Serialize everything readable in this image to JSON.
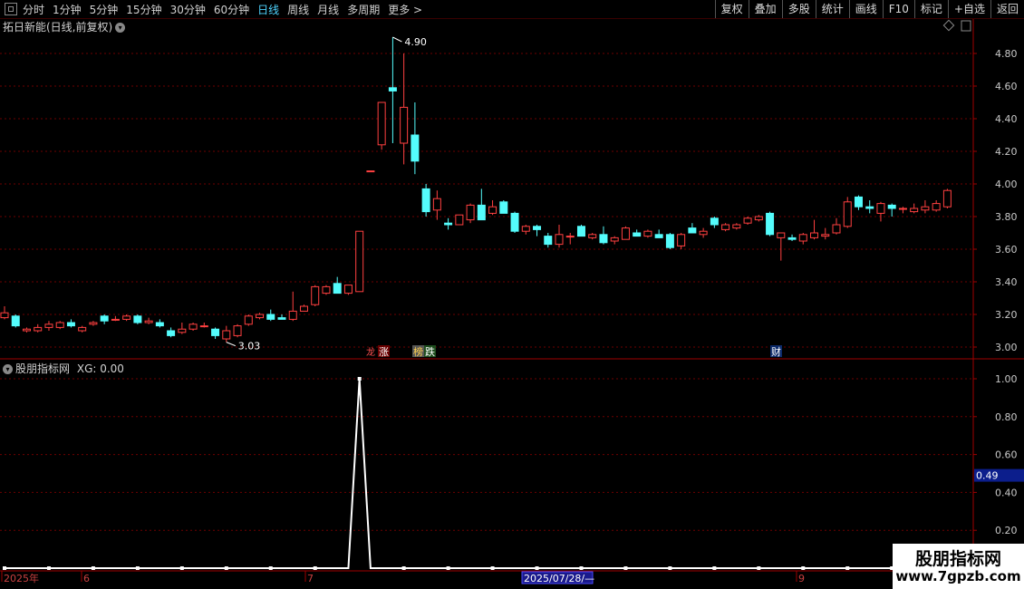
{
  "toolbar": {
    "periods": [
      "分时",
      "1分钟",
      "5分钟",
      "15分钟",
      "30分钟",
      "60分钟",
      "日线",
      "周线",
      "月线",
      "多周期",
      "更多 >"
    ],
    "active_period": "日线",
    "buttons": [
      "复权",
      "叠加",
      "多股",
      "统计",
      "画线",
      "F10",
      "标记",
      "+自选",
      "返回"
    ]
  },
  "main_panel": {
    "title": "拓日新能(日线,前复权)",
    "high_label": "4.90",
    "low_label": "3.03",
    "events": [
      "涨",
      "跌",
      "财"
    ],
    "event_prefix": [
      "龙",
      "榜"
    ]
  },
  "indicator_panel": {
    "title": "股朋指标网",
    "value_text": "XG: 0.00",
    "current_value": "0.49"
  },
  "colors": {
    "up": "#ff4040",
    "down": "#54fcfc",
    "grid": "#6e0000",
    "border": "#a00000",
    "axis_text": "#c8c8c8",
    "line": "#ffffff"
  },
  "chart_data": {
    "type": "candlestick",
    "ylim": [
      2.95,
      5.0
    ],
    "y_ticks": [
      "4.80",
      "4.60",
      "4.40",
      "4.20",
      "4.00",
      "3.80",
      "3.60",
      "3.40",
      "3.20",
      "3.00"
    ],
    "ind_ylim": [
      0,
      1.1
    ],
    "ind_ticks": [
      "1.00",
      "0.80",
      "0.60",
      "0.40",
      "0.20"
    ],
    "x_labels": [
      "2025年",
      "6",
      "7",
      "2025/07/28/—",
      "9"
    ],
    "ohlc": [
      [
        3.18,
        3.25,
        3.17,
        3.21
      ],
      [
        3.19,
        3.2,
        3.12,
        3.13
      ],
      [
        3.1,
        3.12,
        3.09,
        3.11
      ],
      [
        3.1,
        3.14,
        3.09,
        3.12
      ],
      [
        3.12,
        3.16,
        3.1,
        3.14
      ],
      [
        3.12,
        3.16,
        3.11,
        3.15
      ],
      [
        3.15,
        3.17,
        3.12,
        3.13
      ],
      [
        3.1,
        3.13,
        3.09,
        3.12
      ],
      [
        3.14,
        3.16,
        3.13,
        3.15
      ],
      [
        3.19,
        3.2,
        3.14,
        3.16
      ],
      [
        3.17,
        3.19,
        3.16,
        3.17
      ],
      [
        3.17,
        3.2,
        3.16,
        3.19
      ],
      [
        3.19,
        3.2,
        3.14,
        3.15
      ],
      [
        3.15,
        3.18,
        3.14,
        3.16
      ],
      [
        3.15,
        3.17,
        3.12,
        3.13
      ],
      [
        3.1,
        3.12,
        3.06,
        3.07
      ],
      [
        3.09,
        3.15,
        3.08,
        3.11
      ],
      [
        3.11,
        3.15,
        3.1,
        3.14
      ],
      [
        3.13,
        3.15,
        3.12,
        3.13
      ],
      [
        3.11,
        3.12,
        3.05,
        3.07
      ],
      [
        3.05,
        3.13,
        3.03,
        3.1
      ],
      [
        3.07,
        3.14,
        3.06,
        3.13
      ],
      [
        3.14,
        3.2,
        3.13,
        3.19
      ],
      [
        3.18,
        3.21,
        3.17,
        3.2
      ],
      [
        3.2,
        3.23,
        3.16,
        3.17
      ],
      [
        3.18,
        3.2,
        3.17,
        3.17
      ],
      [
        3.17,
        3.34,
        3.16,
        3.22
      ],
      [
        3.22,
        3.26,
        3.22,
        3.25
      ],
      [
        3.26,
        3.38,
        3.25,
        3.37
      ],
      [
        3.33,
        3.38,
        3.32,
        3.37
      ],
      [
        3.39,
        3.43,
        3.33,
        3.33
      ],
      [
        3.33,
        3.38,
        3.32,
        3.38
      ],
      [
        3.34,
        3.71,
        3.34,
        3.71
      ],
      [
        4.08,
        4.08,
        4.08,
        4.08
      ],
      [
        4.24,
        4.5,
        4.21,
        4.5
      ],
      [
        4.59,
        4.9,
        4.25,
        4.57
      ],
      [
        4.25,
        4.8,
        4.12,
        4.47
      ],
      [
        4.3,
        4.5,
        4.06,
        4.14
      ],
      [
        3.97,
        4.0,
        3.8,
        3.83
      ],
      [
        3.84,
        3.96,
        3.78,
        3.91
      ],
      [
        3.76,
        3.79,
        3.72,
        3.75
      ],
      [
        3.75,
        3.81,
        3.75,
        3.81
      ],
      [
        3.78,
        3.88,
        3.76,
        3.87
      ],
      [
        3.87,
        3.97,
        3.78,
        3.78
      ],
      [
        3.82,
        3.9,
        3.81,
        3.86
      ],
      [
        3.89,
        3.9,
        3.82,
        3.82
      ],
      [
        3.82,
        3.83,
        3.7,
        3.71
      ],
      [
        3.71,
        3.75,
        3.69,
        3.74
      ],
      [
        3.74,
        3.75,
        3.68,
        3.72
      ],
      [
        3.68,
        3.7,
        3.61,
        3.63
      ],
      [
        3.63,
        3.75,
        3.61,
        3.69
      ],
      [
        3.68,
        3.7,
        3.63,
        3.68
      ],
      [
        3.74,
        3.75,
        3.68,
        3.68
      ],
      [
        3.67,
        3.7,
        3.66,
        3.69
      ],
      [
        3.69,
        3.74,
        3.63,
        3.64
      ],
      [
        3.65,
        3.68,
        3.63,
        3.67
      ],
      [
        3.66,
        3.74,
        3.66,
        3.73
      ],
      [
        3.7,
        3.72,
        3.68,
        3.68
      ],
      [
        3.68,
        3.72,
        3.67,
        3.71
      ],
      [
        3.69,
        3.72,
        3.67,
        3.67
      ],
      [
        3.69,
        3.7,
        3.6,
        3.61
      ],
      [
        3.62,
        3.7,
        3.6,
        3.69
      ],
      [
        3.73,
        3.76,
        3.7,
        3.7
      ],
      [
        3.69,
        3.73,
        3.67,
        3.71
      ],
      [
        3.79,
        3.8,
        3.73,
        3.75
      ],
      [
        3.72,
        3.76,
        3.71,
        3.75
      ],
      [
        3.73,
        3.76,
        3.72,
        3.75
      ],
      [
        3.76,
        3.8,
        3.75,
        3.79
      ],
      [
        3.78,
        3.81,
        3.77,
        3.8
      ],
      [
        3.82,
        3.83,
        3.68,
        3.69
      ],
      [
        3.67,
        3.7,
        3.53,
        3.7
      ],
      [
        3.67,
        3.69,
        3.65,
        3.66
      ],
      [
        3.65,
        3.7,
        3.63,
        3.69
      ],
      [
        3.67,
        3.78,
        3.66,
        3.7
      ],
      [
        3.68,
        3.73,
        3.66,
        3.69
      ],
      [
        3.7,
        3.79,
        3.69,
        3.75
      ],
      [
        3.74,
        3.92,
        3.73,
        3.89
      ],
      [
        3.92,
        3.93,
        3.84,
        3.86
      ],
      [
        3.86,
        3.9,
        3.82,
        3.85
      ],
      [
        3.82,
        3.89,
        3.77,
        3.88
      ],
      [
        3.87,
        3.88,
        3.8,
        3.85
      ],
      [
        3.85,
        3.86,
        3.82,
        3.85
      ],
      [
        3.83,
        3.88,
        3.82,
        3.85
      ],
      [
        3.84,
        3.9,
        3.82,
        3.86
      ],
      [
        3.84,
        3.9,
        3.83,
        3.88
      ],
      [
        3.86,
        3.97,
        3.85,
        3.96
      ]
    ],
    "xg_values": [
      0,
      0,
      0,
      0,
      0,
      0,
      0,
      0,
      0,
      0,
      0,
      0,
      0,
      0,
      0,
      0,
      0,
      0,
      0,
      0,
      0,
      0,
      0,
      0,
      0,
      0,
      0,
      0,
      0,
      0,
      0,
      0,
      1,
      0,
      0,
      0,
      0,
      0,
      0,
      0,
      0,
      0,
      0,
      0,
      0,
      0,
      0,
      0,
      0,
      0,
      0,
      0,
      0,
      0,
      0,
      0,
      0,
      0,
      0,
      0,
      0,
      0,
      0,
      0,
      0,
      0,
      0,
      0,
      0,
      0,
      0,
      0,
      0,
      0,
      0,
      0,
      0,
      0,
      0,
      0,
      0,
      0,
      0,
      0,
      0,
      0
    ]
  },
  "watermark": {
    "title": "股朋指标网",
    "url": "www.7gpzb.com"
  }
}
